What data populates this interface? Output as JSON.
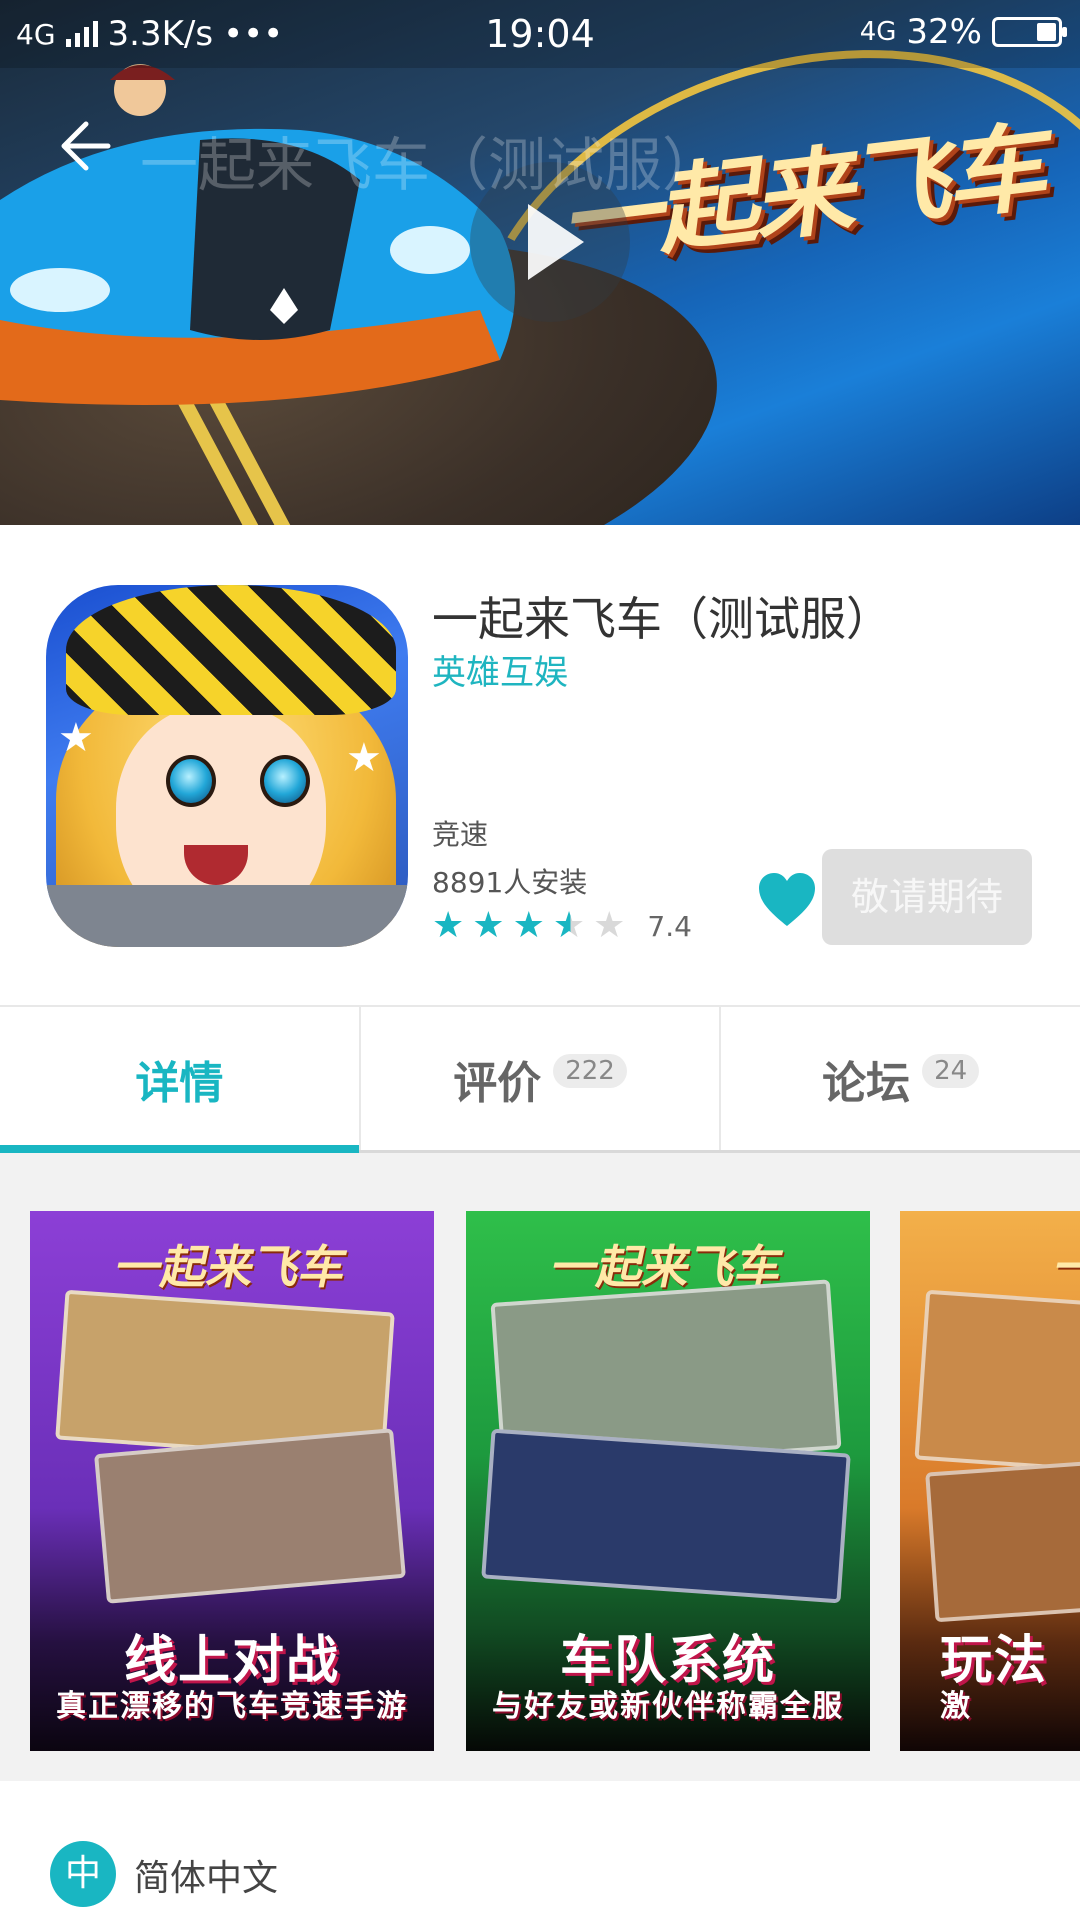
{
  "status_bar": {
    "network": "4G",
    "speed": "3.3K/s",
    "dots": "•••",
    "time": "19:04",
    "network_right": "4G",
    "battery": "32%",
    "battery_level": 0.32
  },
  "header": {
    "title": "一起来飞车（测试服）",
    "banner_logo": "一起来飞车"
  },
  "app": {
    "name": "一起来飞车（测试服）",
    "developer": "英雄互娱",
    "category": "竞速",
    "installs": "8891人安装",
    "rating_value": 3.5,
    "rating_max": 5,
    "score": "7.4",
    "action_button": "敬请期待"
  },
  "tabs": [
    {
      "label": "详情",
      "badge": ""
    },
    {
      "label": "评价",
      "badge": "222"
    },
    {
      "label": "论坛",
      "badge": "24"
    }
  ],
  "screenshots": [
    {
      "logo": "一起来飞车",
      "slogan": "线上对战",
      "sub": "真正漂移的飞车竞速手游"
    },
    {
      "logo": "一起来飞车",
      "slogan": "车队系统",
      "sub": "与好友或新伙伴称霸全服"
    },
    {
      "logo": "一起",
      "slogan": "玩法",
      "sub": "激"
    }
  ],
  "language": {
    "icon_char": "中",
    "label": "简体中文"
  },
  "colors": {
    "accent": "#19b6c2",
    "button_disabled": "#dedede"
  }
}
